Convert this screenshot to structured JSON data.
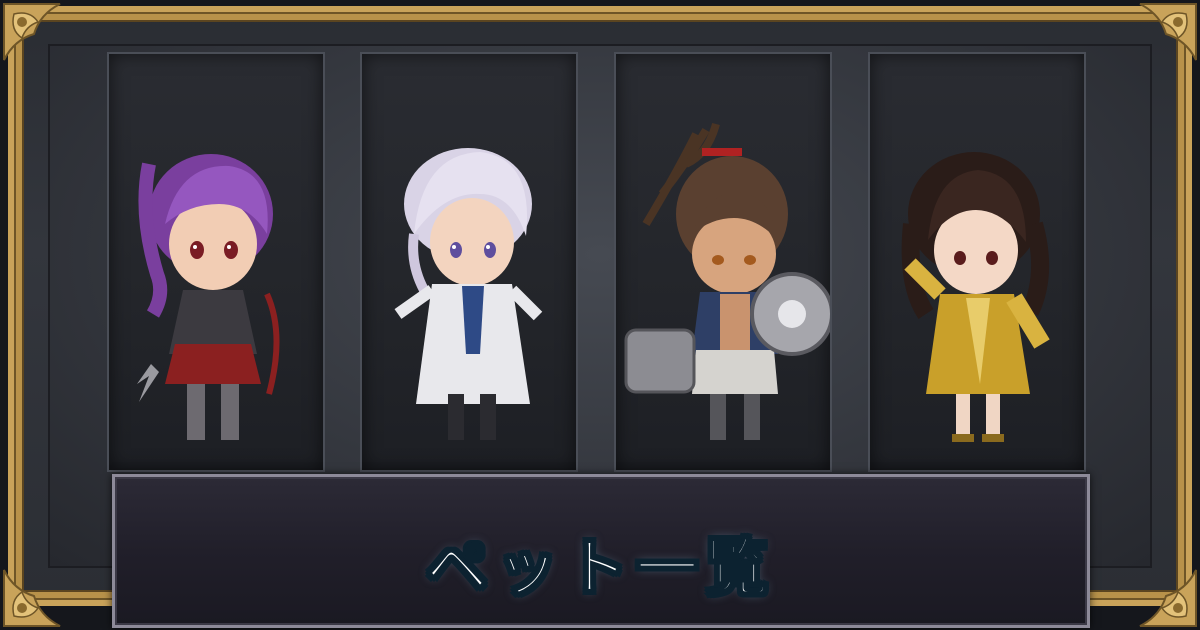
{
  "banner": {
    "title": "ペット一覧"
  },
  "characters": [
    {
      "name": "purple-haired-warrior-pet",
      "hair_color": "#8a4fb0",
      "outfit_color": "#8b2020"
    },
    {
      "name": "silver-haired-mage-pet",
      "hair_color": "#d9d3e6",
      "outfit_color": "#e8e8ec"
    },
    {
      "name": "dreadlocked-brawler-pet",
      "hair_color": "#4a3424",
      "outfit_color": "#2e3f66"
    },
    {
      "name": "dark-haired-golden-robe-pet",
      "hair_color": "#2a1c18",
      "outfit_color": "#c9a02a"
    }
  ],
  "colors": {
    "frame_gold": "#c9a35a",
    "panel_bg": "#23252a",
    "banner_text": "#ffffff",
    "banner_outline": "#0c2230"
  }
}
